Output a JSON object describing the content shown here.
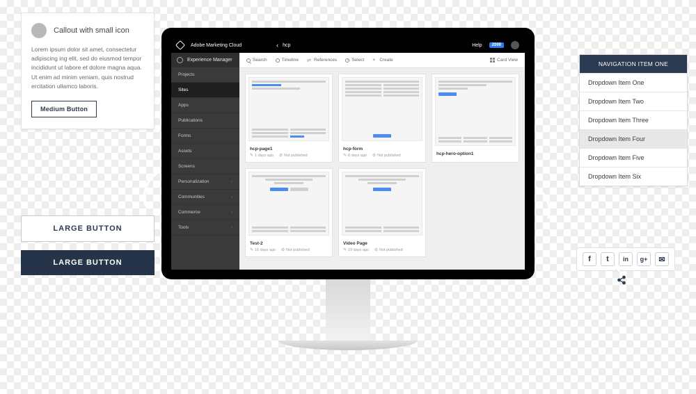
{
  "callout": {
    "title": "Callout with small icon",
    "body": "Lorem ipsum dolor sit amet, consectetur adipiscing ing elit, sed do eiusmod tempor incididunt ut labore et dolore magna aqua. Ut enim ad minim veniam, quis nostrud ercitation ullamco laboris.",
    "button": "Medium Button"
  },
  "large_buttons": {
    "outline": "LARGE BUTTON",
    "solid": "LARGE BUTTON"
  },
  "topbar": {
    "product": "Adobe Marketing Cloud",
    "back_glyph": "‹",
    "crumb": "hcp",
    "help": "Help",
    "badge": "2000"
  },
  "sidebar": {
    "head": "Experience Manager",
    "items": [
      {
        "label": "Projects",
        "has_arrow": false,
        "active": false
      },
      {
        "label": "Sites",
        "has_arrow": false,
        "active": true
      },
      {
        "label": "Apps",
        "has_arrow": false,
        "active": false
      },
      {
        "label": "Publications",
        "has_arrow": false,
        "active": false
      },
      {
        "label": "Forms",
        "has_arrow": false,
        "active": false
      },
      {
        "label": "Assets",
        "has_arrow": false,
        "active": false
      },
      {
        "label": "Screens",
        "has_arrow": false,
        "active": false
      },
      {
        "label": "Personalization",
        "has_arrow": true,
        "active": false
      },
      {
        "label": "Communities",
        "has_arrow": true,
        "active": false
      },
      {
        "label": "Commerce",
        "has_arrow": true,
        "active": false
      },
      {
        "label": "Tools",
        "has_arrow": true,
        "active": false
      }
    ]
  },
  "actionbar": {
    "search": "Search",
    "timeline": "Timeline",
    "references": "References",
    "select": "Select",
    "create": "Create",
    "view": "Card View"
  },
  "cards": [
    {
      "name": "hcp-page1",
      "modified": "1 days ago",
      "status": "Not published"
    },
    {
      "name": "hcp-form",
      "modified": "8 days ago",
      "status": "Not published"
    },
    {
      "name": "hcp-hero-option1",
      "modified": "",
      "status": ""
    },
    {
      "name": "Test-2",
      "modified": "16 days ago",
      "status": "Not published"
    },
    {
      "name": "Video Page",
      "modified": "19 days ago",
      "status": "Not published"
    }
  ],
  "navdd": {
    "head": "NAVIGATION ITEM ONE",
    "items": [
      "Dropdown Item One",
      "Dropdown Item Two",
      "Dropdown Item Three",
      "Dropdown Item Four",
      "Dropdown Item Five",
      "Dropdown Item Six"
    ],
    "active_index": 3
  },
  "social": {
    "facebook": "f",
    "twitter": "t",
    "linkedin": "in",
    "google": "g+",
    "email": "✉",
    "share": "<"
  }
}
